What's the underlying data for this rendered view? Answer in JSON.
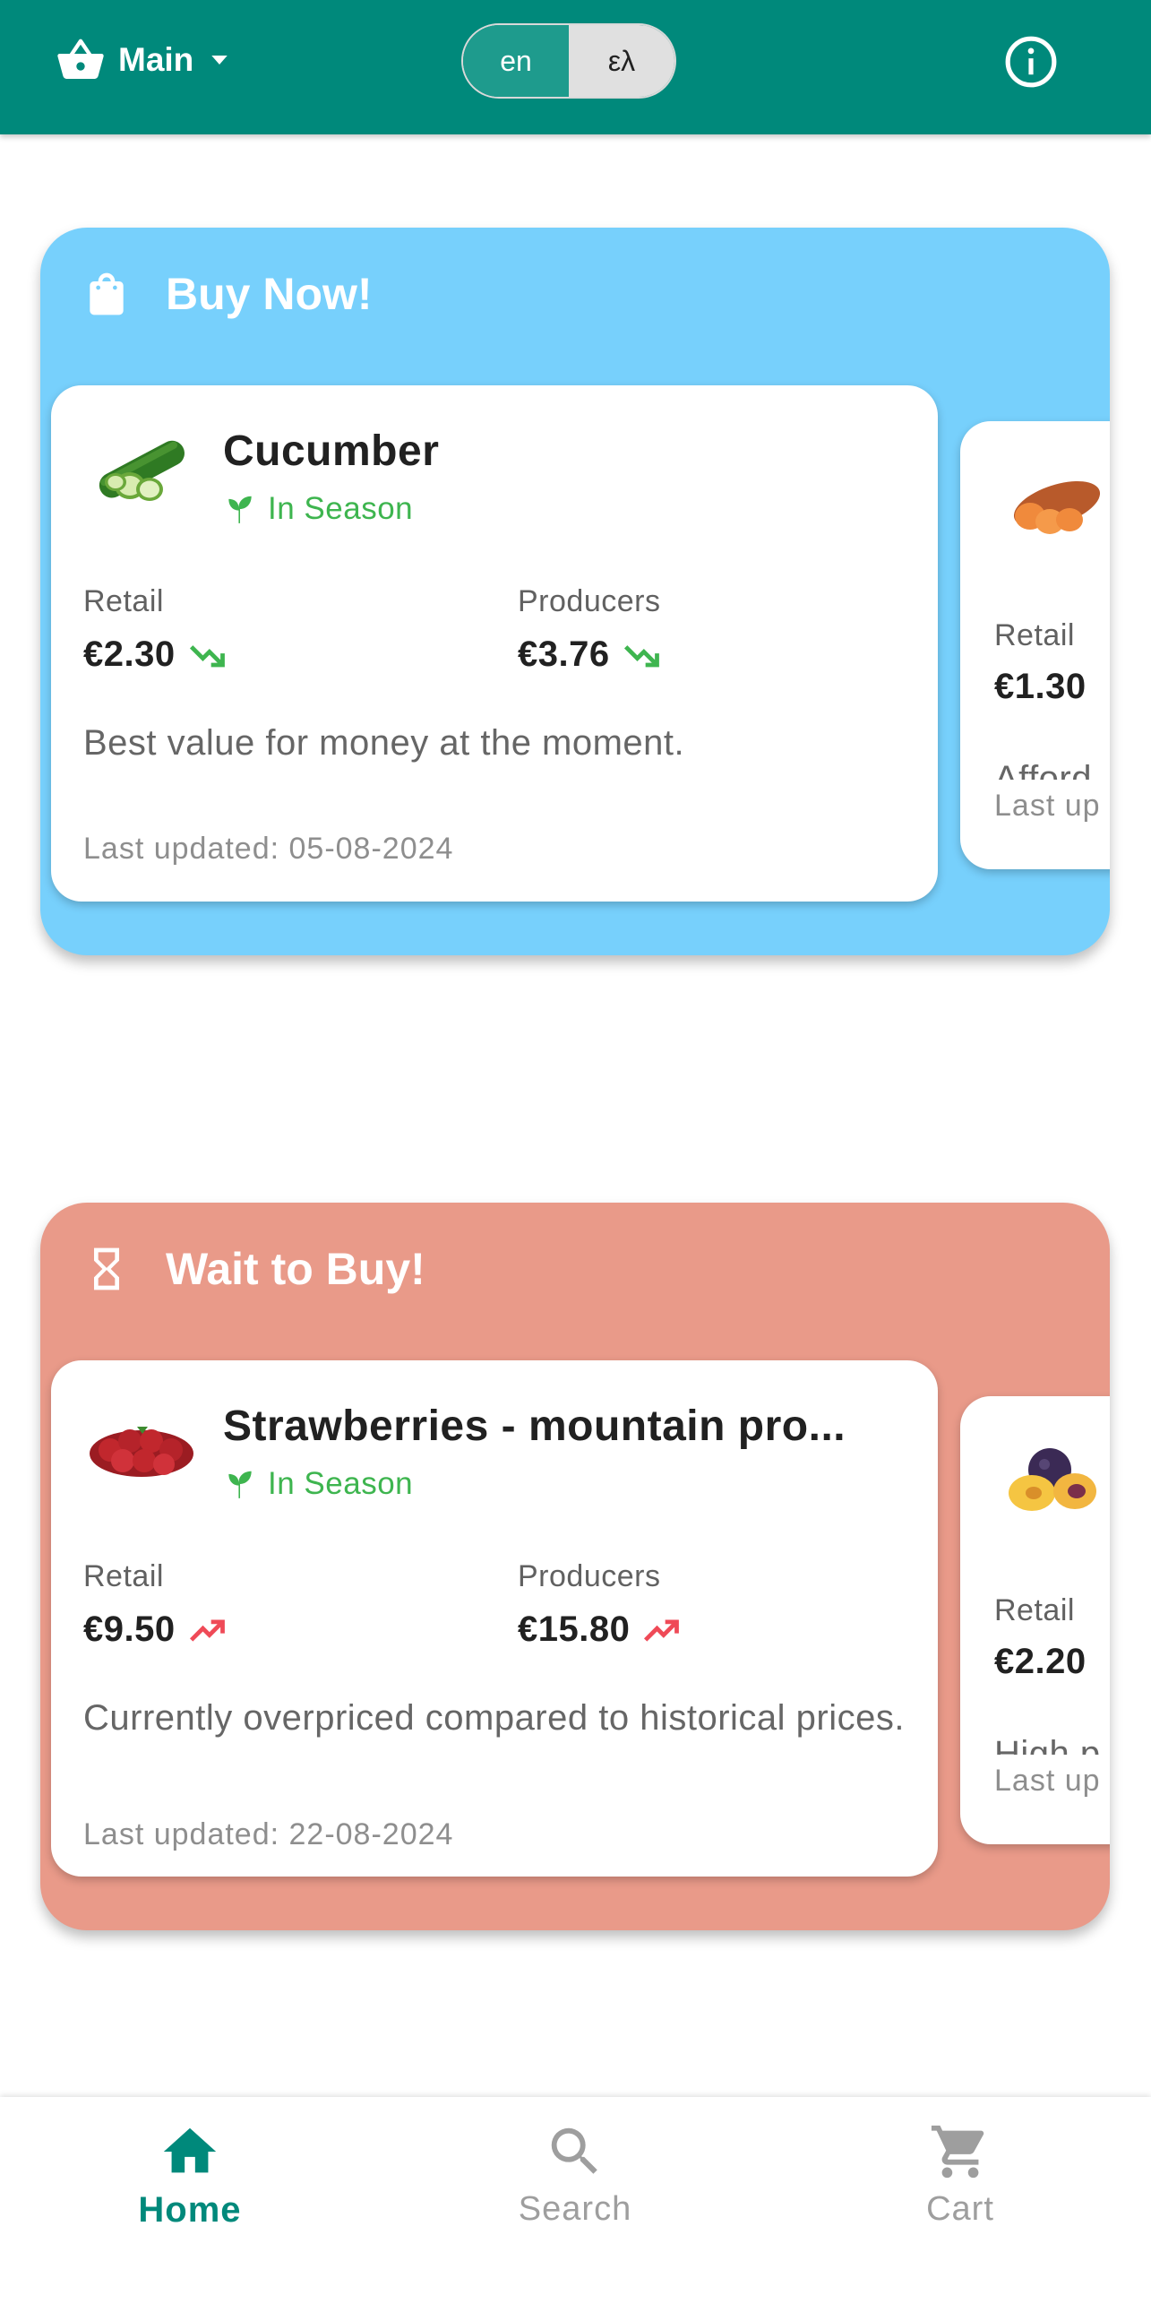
{
  "header": {
    "store_label": "Main",
    "languages": [
      "en",
      "ελ"
    ],
    "active_language": "ελ",
    "brand_color": "#00897b"
  },
  "buy_now": {
    "title": "Buy Now!",
    "color": "#77d0fc",
    "main_card": {
      "name": "Cucumber",
      "season": "In Season",
      "retail_label": "Retail",
      "retail_price": "€2.30",
      "retail_trend": "down",
      "producers_label": "Producers",
      "producers_price": "€3.76",
      "producers_trend": "down",
      "description": "Best value for money at the moment.",
      "updated": "Last updated: 05-08-2024"
    },
    "peek_card": {
      "retail_label": "Retail",
      "retail_price": "€1.30",
      "description": "Afford",
      "updated": "Last up"
    }
  },
  "wait": {
    "title": "Wait to Buy!",
    "color": "#e99a89",
    "main_card": {
      "name": "Strawberries - mountain pro...",
      "season": "In Season",
      "retail_label": "Retail",
      "retail_price": "€9.50",
      "retail_trend": "up",
      "producers_label": "Producers",
      "producers_price": "€15.80",
      "producers_trend": "up",
      "description": "Currently overpriced compared to historical prices.",
      "updated": "Last updated: 22-08-2024"
    },
    "peek_card": {
      "retail_label": "Retail",
      "retail_price": "€2.20",
      "description": "High p",
      "updated": "Last up"
    }
  },
  "nav": {
    "home": "Home",
    "search": "Search",
    "cart": "Cart",
    "active": "home"
  }
}
